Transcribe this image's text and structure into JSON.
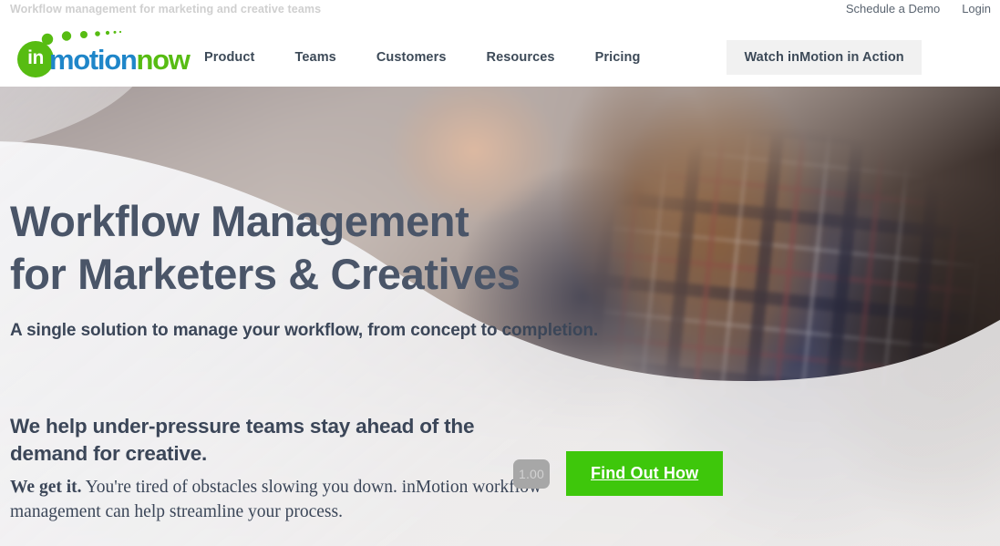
{
  "utility": {
    "tagline": "Workflow management for marketing and creative teams",
    "links": [
      {
        "label": "Schedule a Demo",
        "name": "schedule-demo-link"
      },
      {
        "label": "Login",
        "name": "login-link"
      }
    ]
  },
  "brand": {
    "mark_text": "in",
    "word_motion": "motion",
    "word_now": "now",
    "mark_color": "#57bc12",
    "motion_color": "#1f86c9",
    "now_color": "#57bc12"
  },
  "nav": {
    "items": [
      {
        "label": "Product"
      },
      {
        "label": "Teams"
      },
      {
        "label": "Customers"
      },
      {
        "label": "Resources"
      },
      {
        "label": "Pricing"
      }
    ],
    "cta_label": "Watch inMotion in Action",
    "cta_bg": "#f1f1f1"
  },
  "hero": {
    "title_line1": "Workflow Management",
    "title_line2": "for Marketers & Creatives",
    "subtitle": "A single solution to manage your workflow, from concept to completion.",
    "lead": "We help under-pressure teams stay ahead of the demand for creative.",
    "body_strong": "We get it.",
    "body_rest": " You're tired of obstacles slowing you down. inMotion workflow management can help streamline your process.",
    "title_color": "#4a5568"
  },
  "cta": {
    "counter_value": "1.00",
    "button_label": "Find Out How",
    "button_color": "#3ec70b",
    "counter_bg": "#a7a7a7"
  }
}
